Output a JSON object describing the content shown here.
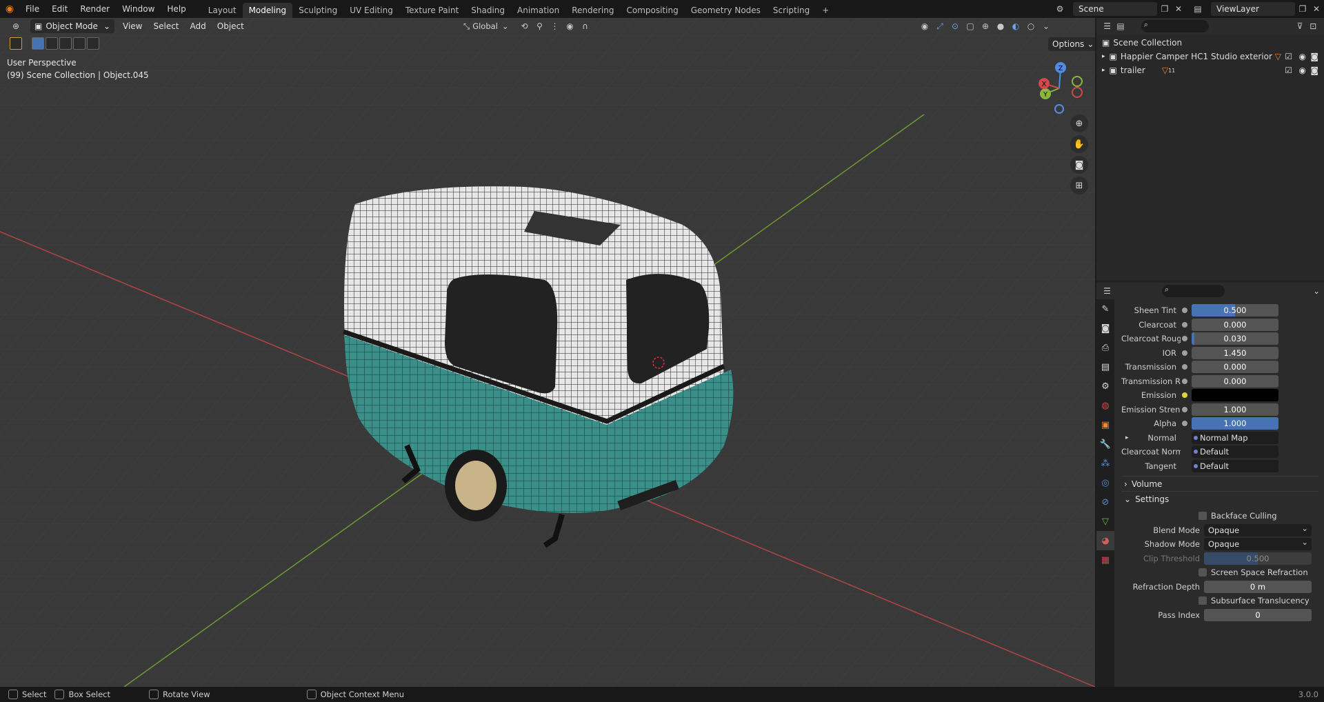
{
  "topbar": {
    "menus": [
      "File",
      "Edit",
      "Render",
      "Window",
      "Help"
    ],
    "workspaces": [
      "Layout",
      "Modeling",
      "Sculpting",
      "UV Editing",
      "Texture Paint",
      "Shading",
      "Animation",
      "Rendering",
      "Compositing",
      "Geometry Nodes",
      "Scripting"
    ],
    "active_workspace": "Modeling",
    "add_tab": "+",
    "scene": "Scene",
    "view_layer": "ViewLayer"
  },
  "viewport": {
    "mode": "Object Mode",
    "menus": [
      "View",
      "Select",
      "Add",
      "Object"
    ],
    "orientation": "Global",
    "options_label": "Options",
    "perspective": "User Perspective",
    "collection_info": "(99) Scene Collection | Object.045",
    "gizmo": {
      "z": "Z",
      "y": "Y",
      "x": "X"
    }
  },
  "outliner": {
    "root": "Scene Collection",
    "items": [
      {
        "label": "Happier Camper HC1 Studio  exterior"
      },
      {
        "label": "trailer",
        "badge": "11"
      }
    ]
  },
  "properties": {
    "fields": [
      {
        "label": "Sheen Tint",
        "value": "0.500",
        "fill": 0.5
      },
      {
        "label": "Clearcoat",
        "value": "0.000",
        "fill": 0
      },
      {
        "label": "Clearcoat Roughn...",
        "value": "0.030",
        "fill": 0.03
      },
      {
        "label": "IOR",
        "value": "1.450",
        "fill": 0
      },
      {
        "label": "Transmission",
        "value": "0.000",
        "fill": 0
      },
      {
        "label": "Transmission Rou...",
        "value": "0.000",
        "fill": 0
      },
      {
        "label": "Emission",
        "value": "",
        "color": "#000000"
      },
      {
        "label": "Emission Strength",
        "value": "1.000",
        "fill": 0
      },
      {
        "label": "Alpha",
        "value": "1.000",
        "fill": 1
      }
    ],
    "links": [
      {
        "label": "Normal",
        "value": "Normal Map"
      },
      {
        "label": "Clearcoat Normal",
        "value": "Default"
      },
      {
        "label": "Tangent",
        "value": "Default"
      }
    ],
    "volume_label": "Volume",
    "settings_label": "Settings",
    "backface_culling": "Backface Culling",
    "blend_mode_label": "Blend Mode",
    "blend_mode": "Opaque",
    "shadow_mode_label": "Shadow Mode",
    "shadow_mode": "Opaque",
    "clip_threshold_label": "Clip Threshold",
    "clip_threshold": "0.500",
    "screen_space_refraction": "Screen Space Refraction",
    "refraction_depth_label": "Refraction Depth",
    "refraction_depth": "0 m",
    "subsurface_translucency": "Subsurface Translucency",
    "pass_index_label": "Pass Index",
    "pass_index": "0"
  },
  "statusbar": {
    "select": "Select",
    "box_select": "Box Select",
    "rotate_view": "Rotate View",
    "context_menu": "Object Context Menu",
    "version": "3.0.0"
  },
  "colors": {
    "accent": "#4772b3",
    "teal": "#3a8f88",
    "x_axis": "#c04848",
    "y_axis": "#7da33a"
  }
}
